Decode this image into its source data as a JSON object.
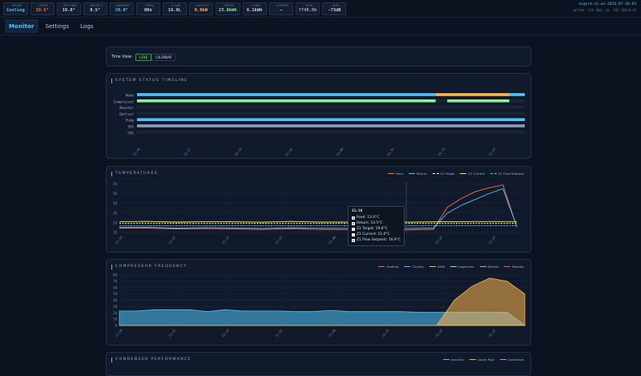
{
  "topbar": {
    "chips": [
      {
        "label": "MODE",
        "value": "Cooling",
        "color": "#4fc3f7",
        "icon": "gear-icon"
      },
      {
        "label": "FEED",
        "value": "19.5°",
        "color": "#ff7043",
        "icon": "thermometer-icon"
      },
      {
        "label": "RETURN",
        "value": "19.8°",
        "color": "#c8d3e3",
        "icon": "thermometer-icon"
      },
      {
        "label": "DELTA T",
        "value": "0.5°",
        "color": "#c8d3e3",
        "icon": "thermometer-icon"
      },
      {
        "label": "AMBIENT",
        "value": "20.0°",
        "color": "#4fc3f7",
        "icon": "cloud-icon"
      },
      {
        "label": "FREQ",
        "value": "0Hz",
        "color": "#c8d3e3",
        "icon": "wave-icon"
      },
      {
        "label": "FLOW",
        "value": "16.0L",
        "color": "#c8d3e3",
        "icon": "drop-icon"
      },
      {
        "label": "OUTPUT",
        "value": "0.0kW",
        "color": "#ffb74d",
        "icon": "bolt-icon"
      },
      {
        "label": "PROD",
        "value": "23.6kWh",
        "color": "#8ef09d",
        "icon": "power-icon"
      },
      {
        "label": "CONS",
        "value": "6.1kWh",
        "color": "#c8d3e3",
        "icon": "power-icon"
      },
      {
        "label": "STARTS",
        "value": "–",
        "color": "#c8d3e3",
        "icon": "refresh-icon"
      },
      {
        "label": "RUN",
        "value": "7748.0h",
        "color": "#b39ddb",
        "icon": "clock-icon"
      },
      {
        "label": "WIFI",
        "value": "-73dB",
        "color": "#c8d3e3",
        "icon": "wifi-icon"
      }
    ],
    "host": "asgard-z1-wn-2026-07-20.03",
    "uptime": "uptime: 11h 46m, ip: 192.168.0.24"
  },
  "nav": {
    "tabs": [
      "Monitor",
      "Settings",
      "Logs"
    ],
    "active": 0
  },
  "time_view": {
    "label": "Time View:",
    "live": "LIVE",
    "calendar": "CALENDAR"
  },
  "timeline": {
    "title": "SYSTEM STATUS TIMELINE",
    "rows": [
      "Mode",
      "Compressor",
      "Booster",
      "Defrost",
      "Pump",
      "SH1",
      "CH1"
    ],
    "times": [
      "21:28",
      "21:47",
      "22:14",
      "22:41",
      "23:08",
      "23:35",
      "21:24",
      "21:47"
    ]
  },
  "chart_data": [
    {
      "type": "line",
      "title": "TEMPERATURES",
      "x": [
        "21:28",
        "21:47",
        "22:14",
        "22:41",
        "23:08",
        "23:35",
        "21:24",
        "21:47"
      ],
      "yticks": [
        10,
        20,
        30,
        40,
        50,
        60
      ],
      "ylim": [
        10,
        62
      ],
      "series": [
        {
          "name": "Feed",
          "color": "#ff7043",
          "dash": false,
          "values": [
            14.5,
            14.2,
            14.0,
            13.8,
            13.6,
            13.5,
            13.4,
            13.3,
            13.2,
            13.1,
            13.0,
            13.2,
            36,
            45,
            52,
            56,
            59,
            15.5
          ]
        },
        {
          "name": "Return",
          "color": "#4fc3f7",
          "dash": false,
          "values": [
            15.2,
            15.0,
            14.9,
            14.8,
            14.7,
            14.6,
            14.6,
            14.5,
            14.5,
            14.5,
            14.5,
            14.6,
            30,
            38,
            44,
            50,
            55,
            16
          ]
        },
        {
          "name": "Z1 Target",
          "color": "#ffffff",
          "dash": true,
          "values": [
            19.6,
            19.6,
            19.6,
            19.6,
            19.6,
            19.6,
            19.6,
            19.6,
            19.6,
            19.6,
            19.6,
            19.6,
            19.6,
            19.6,
            19.6,
            19.6,
            19.6,
            19.6
          ]
        },
        {
          "name": "Z1 Current",
          "color": "#ffeb3b",
          "dash": false,
          "values": [
            21.2,
            21.1,
            21.1,
            21.0,
            21.0,
            21.0,
            21.0,
            21.0,
            21.0,
            21.0,
            21.0,
            21.0,
            21.2,
            21.2,
            21.3,
            21.3,
            21.3,
            21.2
          ]
        },
        {
          "name": "Z1 Flow Setpoint",
          "color": "#4dd0e1",
          "dash": true,
          "values": [
            16.9,
            16.9,
            16.9,
            16.9,
            16.9,
            16.9,
            16.9,
            16.9,
            16.9,
            16.9,
            16.9,
            16.9,
            16.9,
            16.9,
            16.9,
            16.9,
            16.9,
            16.9
          ]
        }
      ],
      "tooltip": {
        "time": "21:10",
        "rows": [
          {
            "text": "Feed: 13.0°C",
            "color": "#ff7043"
          },
          {
            "text": "Return: 14.5°C",
            "color": "#4fc3f7"
          },
          {
            "text": "Z1 Target: 19.6°C",
            "color": "#ffffff"
          },
          {
            "text": "Z1 Current: 21.0°C",
            "color": "#ffeb3b"
          },
          {
            "text": "Z1 Flow Setpoint: 16.9°C",
            "color": "#4dd0e1"
          }
        ]
      }
    },
    {
      "type": "area",
      "title": "COMPRESSOR FREQUENCY",
      "x": [
        "21:28",
        "21:47",
        "22:14",
        "22:41",
        "23:08",
        "23:35",
        "21:24",
        "21:47"
      ],
      "yticks": [
        0,
        10,
        20,
        30,
        40,
        50,
        60,
        70,
        80
      ],
      "ylim": [
        0,
        80
      ],
      "series": [
        {
          "name": "Heating",
          "color": "#ff7043"
        },
        {
          "name": "Cooling",
          "color": "#4fc3f7",
          "values": [
            23,
            23,
            25,
            25,
            25,
            22,
            25,
            23,
            23,
            23,
            22,
            22,
            24,
            22,
            22,
            22,
            22,
            21,
            21,
            21,
            21,
            21,
            21,
            0
          ]
        },
        {
          "name": "DHW",
          "color": "#ffb74d",
          "values": [
            0,
            0,
            0,
            0,
            0,
            0,
            0,
            0,
            0,
            0,
            0,
            0,
            0,
            0,
            0,
            0,
            0,
            0,
            0,
            40,
            62,
            75,
            70,
            50
          ]
        },
        {
          "name": "Legionella",
          "color": "#8ef09d"
        },
        {
          "name": "Defrost",
          "color": "#b39ddb"
        },
        {
          "name": "Booster",
          "color": "#ef5350"
        }
      ]
    }
  ],
  "condenser": {
    "title": "CONDENSER PERFORMANCE",
    "legend": [
      {
        "name": "Ambient",
        "color": "#4fc3f7"
      },
      {
        "name": "Liquid Pipe",
        "color": "#ffb74d"
      },
      {
        "name": "Condenser",
        "color": "#b39ddb"
      }
    ]
  }
}
